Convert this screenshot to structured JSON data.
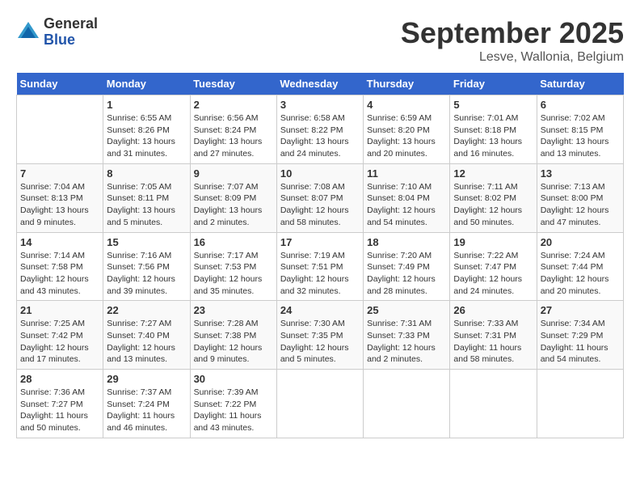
{
  "logo": {
    "general": "General",
    "blue": "Blue"
  },
  "header": {
    "month": "September 2025",
    "location": "Lesve, Wallonia, Belgium"
  },
  "days_of_week": [
    "Sunday",
    "Monday",
    "Tuesday",
    "Wednesday",
    "Thursday",
    "Friday",
    "Saturday"
  ],
  "weeks": [
    [
      {
        "day": "",
        "sunrise": "",
        "sunset": "",
        "daylight": ""
      },
      {
        "day": "1",
        "sunrise": "Sunrise: 6:55 AM",
        "sunset": "Sunset: 8:26 PM",
        "daylight": "Daylight: 13 hours and 31 minutes."
      },
      {
        "day": "2",
        "sunrise": "Sunrise: 6:56 AM",
        "sunset": "Sunset: 8:24 PM",
        "daylight": "Daylight: 13 hours and 27 minutes."
      },
      {
        "day": "3",
        "sunrise": "Sunrise: 6:58 AM",
        "sunset": "Sunset: 8:22 PM",
        "daylight": "Daylight: 13 hours and 24 minutes."
      },
      {
        "day": "4",
        "sunrise": "Sunrise: 6:59 AM",
        "sunset": "Sunset: 8:20 PM",
        "daylight": "Daylight: 13 hours and 20 minutes."
      },
      {
        "day": "5",
        "sunrise": "Sunrise: 7:01 AM",
        "sunset": "Sunset: 8:18 PM",
        "daylight": "Daylight: 13 hours and 16 minutes."
      },
      {
        "day": "6",
        "sunrise": "Sunrise: 7:02 AM",
        "sunset": "Sunset: 8:15 PM",
        "daylight": "Daylight: 13 hours and 13 minutes."
      }
    ],
    [
      {
        "day": "7",
        "sunrise": "Sunrise: 7:04 AM",
        "sunset": "Sunset: 8:13 PM",
        "daylight": "Daylight: 13 hours and 9 minutes."
      },
      {
        "day": "8",
        "sunrise": "Sunrise: 7:05 AM",
        "sunset": "Sunset: 8:11 PM",
        "daylight": "Daylight: 13 hours and 5 minutes."
      },
      {
        "day": "9",
        "sunrise": "Sunrise: 7:07 AM",
        "sunset": "Sunset: 8:09 PM",
        "daylight": "Daylight: 13 hours and 2 minutes."
      },
      {
        "day": "10",
        "sunrise": "Sunrise: 7:08 AM",
        "sunset": "Sunset: 8:07 PM",
        "daylight": "Daylight: 12 hours and 58 minutes."
      },
      {
        "day": "11",
        "sunrise": "Sunrise: 7:10 AM",
        "sunset": "Sunset: 8:04 PM",
        "daylight": "Daylight: 12 hours and 54 minutes."
      },
      {
        "day": "12",
        "sunrise": "Sunrise: 7:11 AM",
        "sunset": "Sunset: 8:02 PM",
        "daylight": "Daylight: 12 hours and 50 minutes."
      },
      {
        "day": "13",
        "sunrise": "Sunrise: 7:13 AM",
        "sunset": "Sunset: 8:00 PM",
        "daylight": "Daylight: 12 hours and 47 minutes."
      }
    ],
    [
      {
        "day": "14",
        "sunrise": "Sunrise: 7:14 AM",
        "sunset": "Sunset: 7:58 PM",
        "daylight": "Daylight: 12 hours and 43 minutes."
      },
      {
        "day": "15",
        "sunrise": "Sunrise: 7:16 AM",
        "sunset": "Sunset: 7:56 PM",
        "daylight": "Daylight: 12 hours and 39 minutes."
      },
      {
        "day": "16",
        "sunrise": "Sunrise: 7:17 AM",
        "sunset": "Sunset: 7:53 PM",
        "daylight": "Daylight: 12 hours and 35 minutes."
      },
      {
        "day": "17",
        "sunrise": "Sunrise: 7:19 AM",
        "sunset": "Sunset: 7:51 PM",
        "daylight": "Daylight: 12 hours and 32 minutes."
      },
      {
        "day": "18",
        "sunrise": "Sunrise: 7:20 AM",
        "sunset": "Sunset: 7:49 PM",
        "daylight": "Daylight: 12 hours and 28 minutes."
      },
      {
        "day": "19",
        "sunrise": "Sunrise: 7:22 AM",
        "sunset": "Sunset: 7:47 PM",
        "daylight": "Daylight: 12 hours and 24 minutes."
      },
      {
        "day": "20",
        "sunrise": "Sunrise: 7:24 AM",
        "sunset": "Sunset: 7:44 PM",
        "daylight": "Daylight: 12 hours and 20 minutes."
      }
    ],
    [
      {
        "day": "21",
        "sunrise": "Sunrise: 7:25 AM",
        "sunset": "Sunset: 7:42 PM",
        "daylight": "Daylight: 12 hours and 17 minutes."
      },
      {
        "day": "22",
        "sunrise": "Sunrise: 7:27 AM",
        "sunset": "Sunset: 7:40 PM",
        "daylight": "Daylight: 12 hours and 13 minutes."
      },
      {
        "day": "23",
        "sunrise": "Sunrise: 7:28 AM",
        "sunset": "Sunset: 7:38 PM",
        "daylight": "Daylight: 12 hours and 9 minutes."
      },
      {
        "day": "24",
        "sunrise": "Sunrise: 7:30 AM",
        "sunset": "Sunset: 7:35 PM",
        "daylight": "Daylight: 12 hours and 5 minutes."
      },
      {
        "day": "25",
        "sunrise": "Sunrise: 7:31 AM",
        "sunset": "Sunset: 7:33 PM",
        "daylight": "Daylight: 12 hours and 2 minutes."
      },
      {
        "day": "26",
        "sunrise": "Sunrise: 7:33 AM",
        "sunset": "Sunset: 7:31 PM",
        "daylight": "Daylight: 11 hours and 58 minutes."
      },
      {
        "day": "27",
        "sunrise": "Sunrise: 7:34 AM",
        "sunset": "Sunset: 7:29 PM",
        "daylight": "Daylight: 11 hours and 54 minutes."
      }
    ],
    [
      {
        "day": "28",
        "sunrise": "Sunrise: 7:36 AM",
        "sunset": "Sunset: 7:27 PM",
        "daylight": "Daylight: 11 hours and 50 minutes."
      },
      {
        "day": "29",
        "sunrise": "Sunrise: 7:37 AM",
        "sunset": "Sunset: 7:24 PM",
        "daylight": "Daylight: 11 hours and 46 minutes."
      },
      {
        "day": "30",
        "sunrise": "Sunrise: 7:39 AM",
        "sunset": "Sunset: 7:22 PM",
        "daylight": "Daylight: 11 hours and 43 minutes."
      },
      {
        "day": "",
        "sunrise": "",
        "sunset": "",
        "daylight": ""
      },
      {
        "day": "",
        "sunrise": "",
        "sunset": "",
        "daylight": ""
      },
      {
        "day": "",
        "sunrise": "",
        "sunset": "",
        "daylight": ""
      },
      {
        "day": "",
        "sunrise": "",
        "sunset": "",
        "daylight": ""
      }
    ]
  ]
}
